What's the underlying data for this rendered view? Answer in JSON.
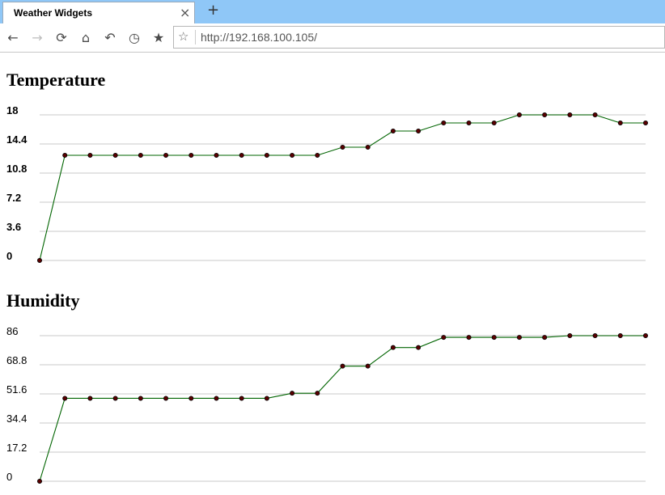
{
  "browser": {
    "tab_title": "Weather Widgets",
    "close_glyph": "×",
    "new_tab_glyph": "+",
    "url": "http://192.168.100.105/",
    "nav_icons": [
      {
        "name": "back-icon",
        "glyph": "←"
      },
      {
        "name": "forward-icon",
        "glyph": "→",
        "disabled": true
      },
      {
        "name": "reload-icon",
        "glyph": "⟳"
      },
      {
        "name": "home-icon",
        "glyph": "⌂"
      },
      {
        "name": "undo-icon",
        "glyph": "↶"
      },
      {
        "name": "history-icon",
        "glyph": "◷"
      },
      {
        "name": "bookmark-icon",
        "glyph": "★"
      }
    ],
    "url_icon": {
      "name": "bookmark-star-icon",
      "glyph": "☆"
    }
  },
  "chart_data": [
    {
      "type": "line",
      "title": "Temperature",
      "ylim": [
        0,
        18
      ],
      "yticks": [
        "0",
        "3.6",
        "7.2",
        "10.8",
        "14.4",
        "18"
      ],
      "tick_bold": true,
      "grid": true,
      "line_color": "#006400",
      "point_color": "#5a0000",
      "values": [
        0,
        13,
        13,
        13,
        13,
        13,
        13,
        13,
        13,
        13,
        13,
        13,
        14,
        14,
        16,
        16,
        17,
        17,
        17,
        18,
        18,
        18,
        18,
        17,
        17
      ]
    },
    {
      "type": "line",
      "title": "Humidity",
      "ylim": [
        0,
        86
      ],
      "yticks": [
        "0",
        "17.2",
        "34.4",
        "51.6",
        "68.8",
        "86"
      ],
      "tick_bold": false,
      "grid": true,
      "line_color": "#006400",
      "point_color": "#5a0000",
      "values": [
        0,
        49,
        49,
        49,
        49,
        49,
        49,
        49,
        49,
        49,
        52,
        52,
        68,
        68,
        79,
        79,
        85,
        85,
        85,
        85,
        85,
        86,
        86,
        86,
        86
      ]
    }
  ]
}
